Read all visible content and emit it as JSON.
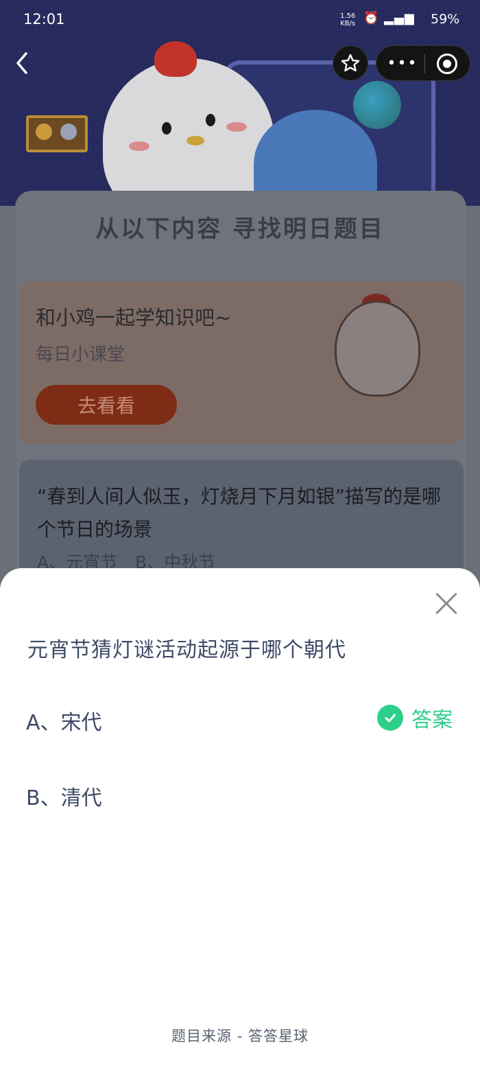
{
  "status_bar": {
    "time": "12:01",
    "net_speed": "1.56",
    "net_unit": "KB/s",
    "battery": "59%"
  },
  "background": {
    "section_title": "从以下内容 寻找明日题目",
    "promo_card": {
      "title": "和小鸡一起学知识吧~",
      "subtitle": "每日小课堂",
      "button": "去看看"
    },
    "question_card": {
      "title": "“春到人间人似玉，灯烧月下月如银”描写的是哪个节日的场景",
      "options": "A、元宵节 B、中秋节"
    }
  },
  "sheet": {
    "question": "元宵节猜灯谜活动起源于哪个朝代",
    "options": [
      {
        "label": "A、宋代",
        "correct": true
      },
      {
        "label": "B、清代",
        "correct": false
      }
    ],
    "answer_label": "答案",
    "source": "题目来源 - 答答星球"
  },
  "icons": [
    "back-icon",
    "star-icon",
    "more-icon",
    "target-icon",
    "close-icon",
    "check-icon"
  ],
  "colors": {
    "accent_green": "#2ecf8a",
    "text_dark_blue": "#3e4a66",
    "overlay_bg": "#1b1d3a"
  }
}
